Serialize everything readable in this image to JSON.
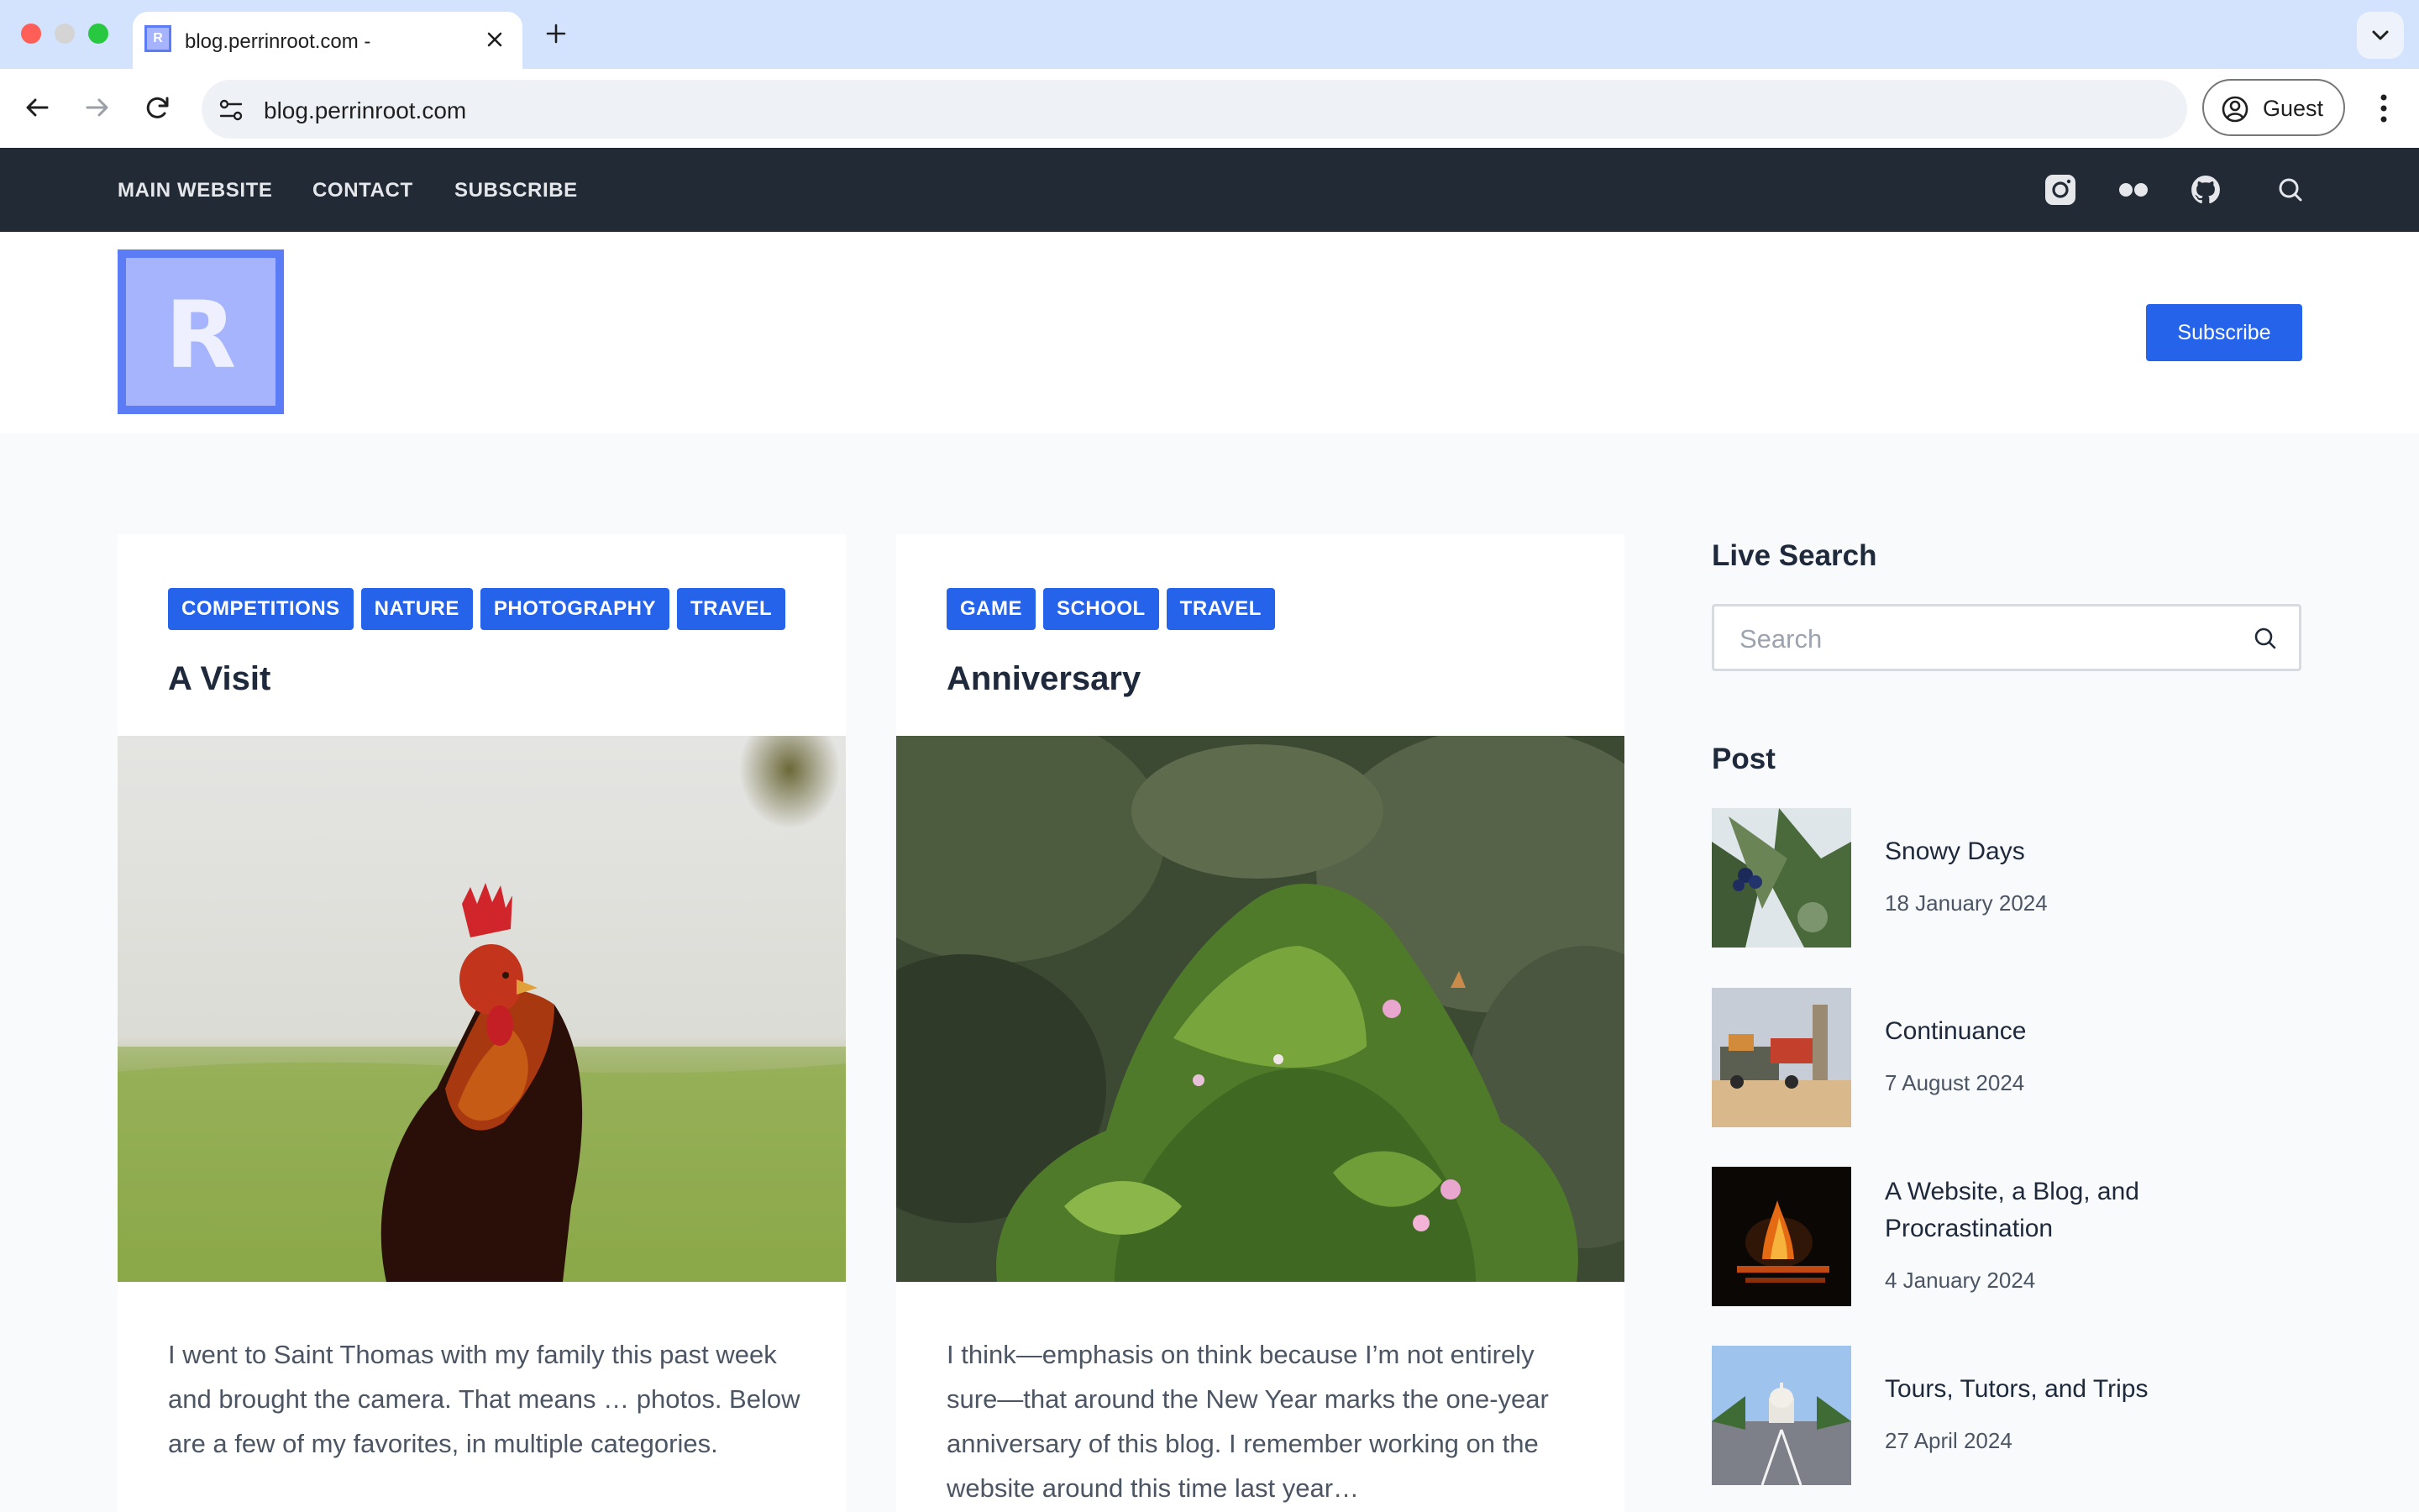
{
  "browser": {
    "tab_title": "blog.perrinroot.com -",
    "url": "blog.perrinroot.com",
    "profile_label": "Guest"
  },
  "site_nav": {
    "links": [
      "MAIN WEBSITE",
      "CONTACT",
      "SUBSCRIBE"
    ],
    "icons": [
      "instagram-icon",
      "flickr-icon",
      "github-icon",
      "search-icon"
    ]
  },
  "header": {
    "logo_letter": "R",
    "subscribe_label": "Subscribe"
  },
  "posts": [
    {
      "tags": [
        "COMPETITIONS",
        "NATURE",
        "PHOTOGRAPHY",
        "TRAVEL"
      ],
      "title": "A Visit",
      "excerpt": "I went to Saint Thomas with my family this past week and brought the camera. That means … photos. Below are a few of my favorites, in multiple categories."
    },
    {
      "tags": [
        "GAME",
        "SCHOOL",
        "TRAVEL"
      ],
      "title": "Anniversary",
      "excerpt": "I think—emphasis on think because I’m not entirely sure—that around the New Year marks the one-year anniversary of this blog. I remember working on the website around this time last year…"
    }
  ],
  "sidebar": {
    "search_heading": "Live Search",
    "search_placeholder": "Search",
    "post_heading": "Post",
    "posts": [
      {
        "title": "Snowy Days",
        "date": "18 January 2024"
      },
      {
        "title": "Continuance",
        "date": "7 August 2024"
      },
      {
        "title": "A Website, a Blog, and Procrastination",
        "date": "4 January 2024"
      },
      {
        "title": "Tours, Tutors, and Trips",
        "date": "27 April 2024"
      }
    ]
  },
  "colors": {
    "accent": "#2563eb",
    "nav_bg": "#222b35",
    "logo_bg": "#a5b4fc",
    "logo_border": "#5b7cf5"
  }
}
